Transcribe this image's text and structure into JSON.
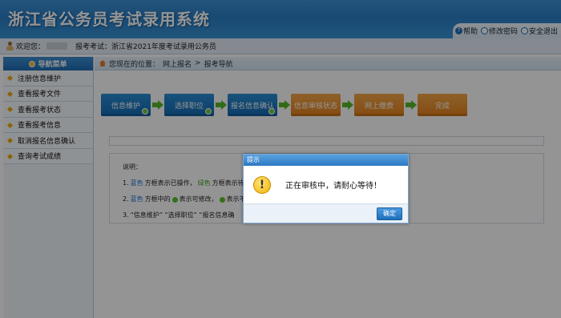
{
  "header": {
    "title": "浙江省公务员考试录用系统",
    "links": {
      "help": "帮助",
      "change_password": "修改密码",
      "logout": "安全退出"
    }
  },
  "infobar": {
    "welcome": "欢迎您：",
    "exam_label": "报考考试：",
    "exam_name": "浙江省2021年度考试录用公务员"
  },
  "sidebar": {
    "header": "导航菜单",
    "items": [
      {
        "label": "注册信息维护"
      },
      {
        "label": "查看报考文件"
      },
      {
        "label": "查看报考状态"
      },
      {
        "label": "查看报考信息"
      },
      {
        "label": "取消报名信息确认"
      },
      {
        "label": "查询考试成绩"
      }
    ]
  },
  "breadcrumb": {
    "prefix": "您现在的位置：",
    "level1": "网上报名",
    "sep": ">",
    "level2": "报考导航"
  },
  "steps": [
    {
      "label": "信息维护",
      "state": "done"
    },
    {
      "label": "选择职位",
      "state": "done"
    },
    {
      "label": "报名信息确认",
      "state": "done"
    },
    {
      "label": "信息审核状态",
      "state": "pending"
    },
    {
      "label": "网上缴费",
      "state": "pending"
    },
    {
      "label": "完成",
      "state": "pending"
    }
  ],
  "description": {
    "heading": "说明：",
    "line1": {
      "num": "1.",
      "blue": "蓝色",
      "mid": "方框表示已操作，",
      "green": "绿色",
      "tail": "方框表示待操"
    },
    "line2": {
      "num": "2.",
      "blue": "蓝色",
      "mid": "方框中的",
      "mid2": "表示可修改，",
      "tail": "表示不"
    },
    "line3": {
      "num": "3.",
      "text": "“信息维护”  “选择职位”  “报名信息确"
    }
  },
  "modal": {
    "title": "提示",
    "message": "正在审核中，请耐心等待！",
    "ok_label": "确定"
  },
  "colors": {
    "header_blue": "#2a7fc7",
    "step_blue": "#1a77c0",
    "step_orange": "#f09230",
    "overlay": "rgba(0,0,0,0.42)"
  }
}
